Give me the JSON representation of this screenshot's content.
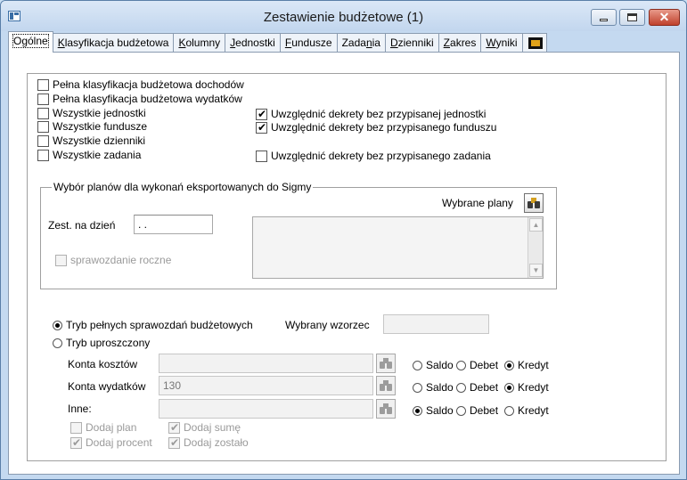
{
  "window": {
    "title": "Zestawienie budżetowe (1)"
  },
  "tabs": [
    {
      "pre": "",
      "key": "",
      "post": "Ogólne"
    },
    {
      "pre": "",
      "key": "K",
      "post": "lasyfikacja budżetowa"
    },
    {
      "pre": "",
      "key": "K",
      "post": "olumny"
    },
    {
      "pre": "",
      "key": "J",
      "post": "ednostki"
    },
    {
      "pre": "",
      "key": "F",
      "post": "undusze"
    },
    {
      "pre": "Zada",
      "key": "n",
      "post": "ia"
    },
    {
      "pre": "",
      "key": "D",
      "post": "zienniki"
    },
    {
      "pre": "",
      "key": "Z",
      "post": "akres"
    },
    {
      "pre": "",
      "key": "W",
      "post": "yniki"
    }
  ],
  "general": {
    "checks": [
      {
        "label": "Pełna klasyfikacja budżetowa dochodów",
        "checked": false
      },
      {
        "label": "Pełna klasyfikacja budżetowa wydatków",
        "checked": false
      },
      {
        "label": "Wszystkie jednostki",
        "checked": false
      },
      {
        "label": "Wszystkie fundusze",
        "checked": false
      },
      {
        "label": "Wszystkie dzienniki",
        "checked": false
      },
      {
        "label": "Wszystkie zadania",
        "checked": false
      }
    ],
    "decrees": [
      {
        "label": "Uwzględnić dekrety bez przypisanej jednostki",
        "checked": true
      },
      {
        "label": "Uwzględnić dekrety bez przypisanego funduszu",
        "checked": true
      },
      {
        "label": "Uwzględnić dekrety bez przypisanego zadania",
        "checked": false
      }
    ]
  },
  "sigma": {
    "legend": "Wybór planów dla wykonań eksportowanych do Sigmy",
    "date_label": "Zest. na dzień",
    "date_value": " . .",
    "selected_plans_label": "Wybrane plany",
    "annual_report_label": "sprawozdanie roczne",
    "annual_report_checked": false
  },
  "mode": {
    "full_label": "Tryb pełnych sprawozdań budżetowych",
    "full_selected": true,
    "simple_label": "Tryb uproszczony",
    "simple_selected": false,
    "template_label": "Wybrany wzorzec",
    "template_value": ""
  },
  "accounts": {
    "rows": [
      {
        "label": "Konta kosztów",
        "value": "",
        "selected": "Kredyt"
      },
      {
        "label": "Konta wydatków",
        "value": "130",
        "selected": "Kredyt"
      },
      {
        "label": "Inne:",
        "value": "",
        "selected": "Saldo"
      }
    ],
    "options": [
      "Saldo",
      "Debet",
      "Kredyt"
    ]
  },
  "extras": {
    "add_plan": {
      "label": "Dodaj plan",
      "checked": false
    },
    "add_sum": {
      "label": "Dodaj sumę",
      "checked": true
    },
    "add_percent": {
      "label": "Dodaj procent",
      "checked": true
    },
    "add_rest": {
      "label": "Dodaj zostało",
      "checked": true
    }
  }
}
